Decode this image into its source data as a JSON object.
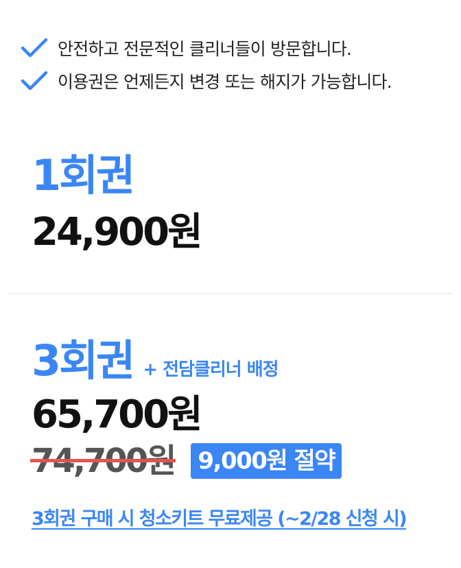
{
  "benefits": [
    {
      "icon": "check-icon",
      "text": "안전하고 전문적인 클리너들이 방문합니다."
    },
    {
      "icon": "check-icon",
      "text": "이용권은 언제든지 변경 또는 해지가 가능합니다."
    }
  ],
  "plans": [
    {
      "name": "1회권",
      "price": "24,900원"
    },
    {
      "name": "3회권",
      "perk": "+ 전담클리너 배정",
      "price": "65,700원",
      "original_price": "74,700원",
      "savings": "9,000원 절약"
    }
  ],
  "promo": {
    "text": "3회권 구매 시 청소키트 무료제공 (~2/28 신청 시)"
  },
  "colors": {
    "accent": "#3a86f5",
    "strike": "#e45454",
    "text": "#111111"
  }
}
